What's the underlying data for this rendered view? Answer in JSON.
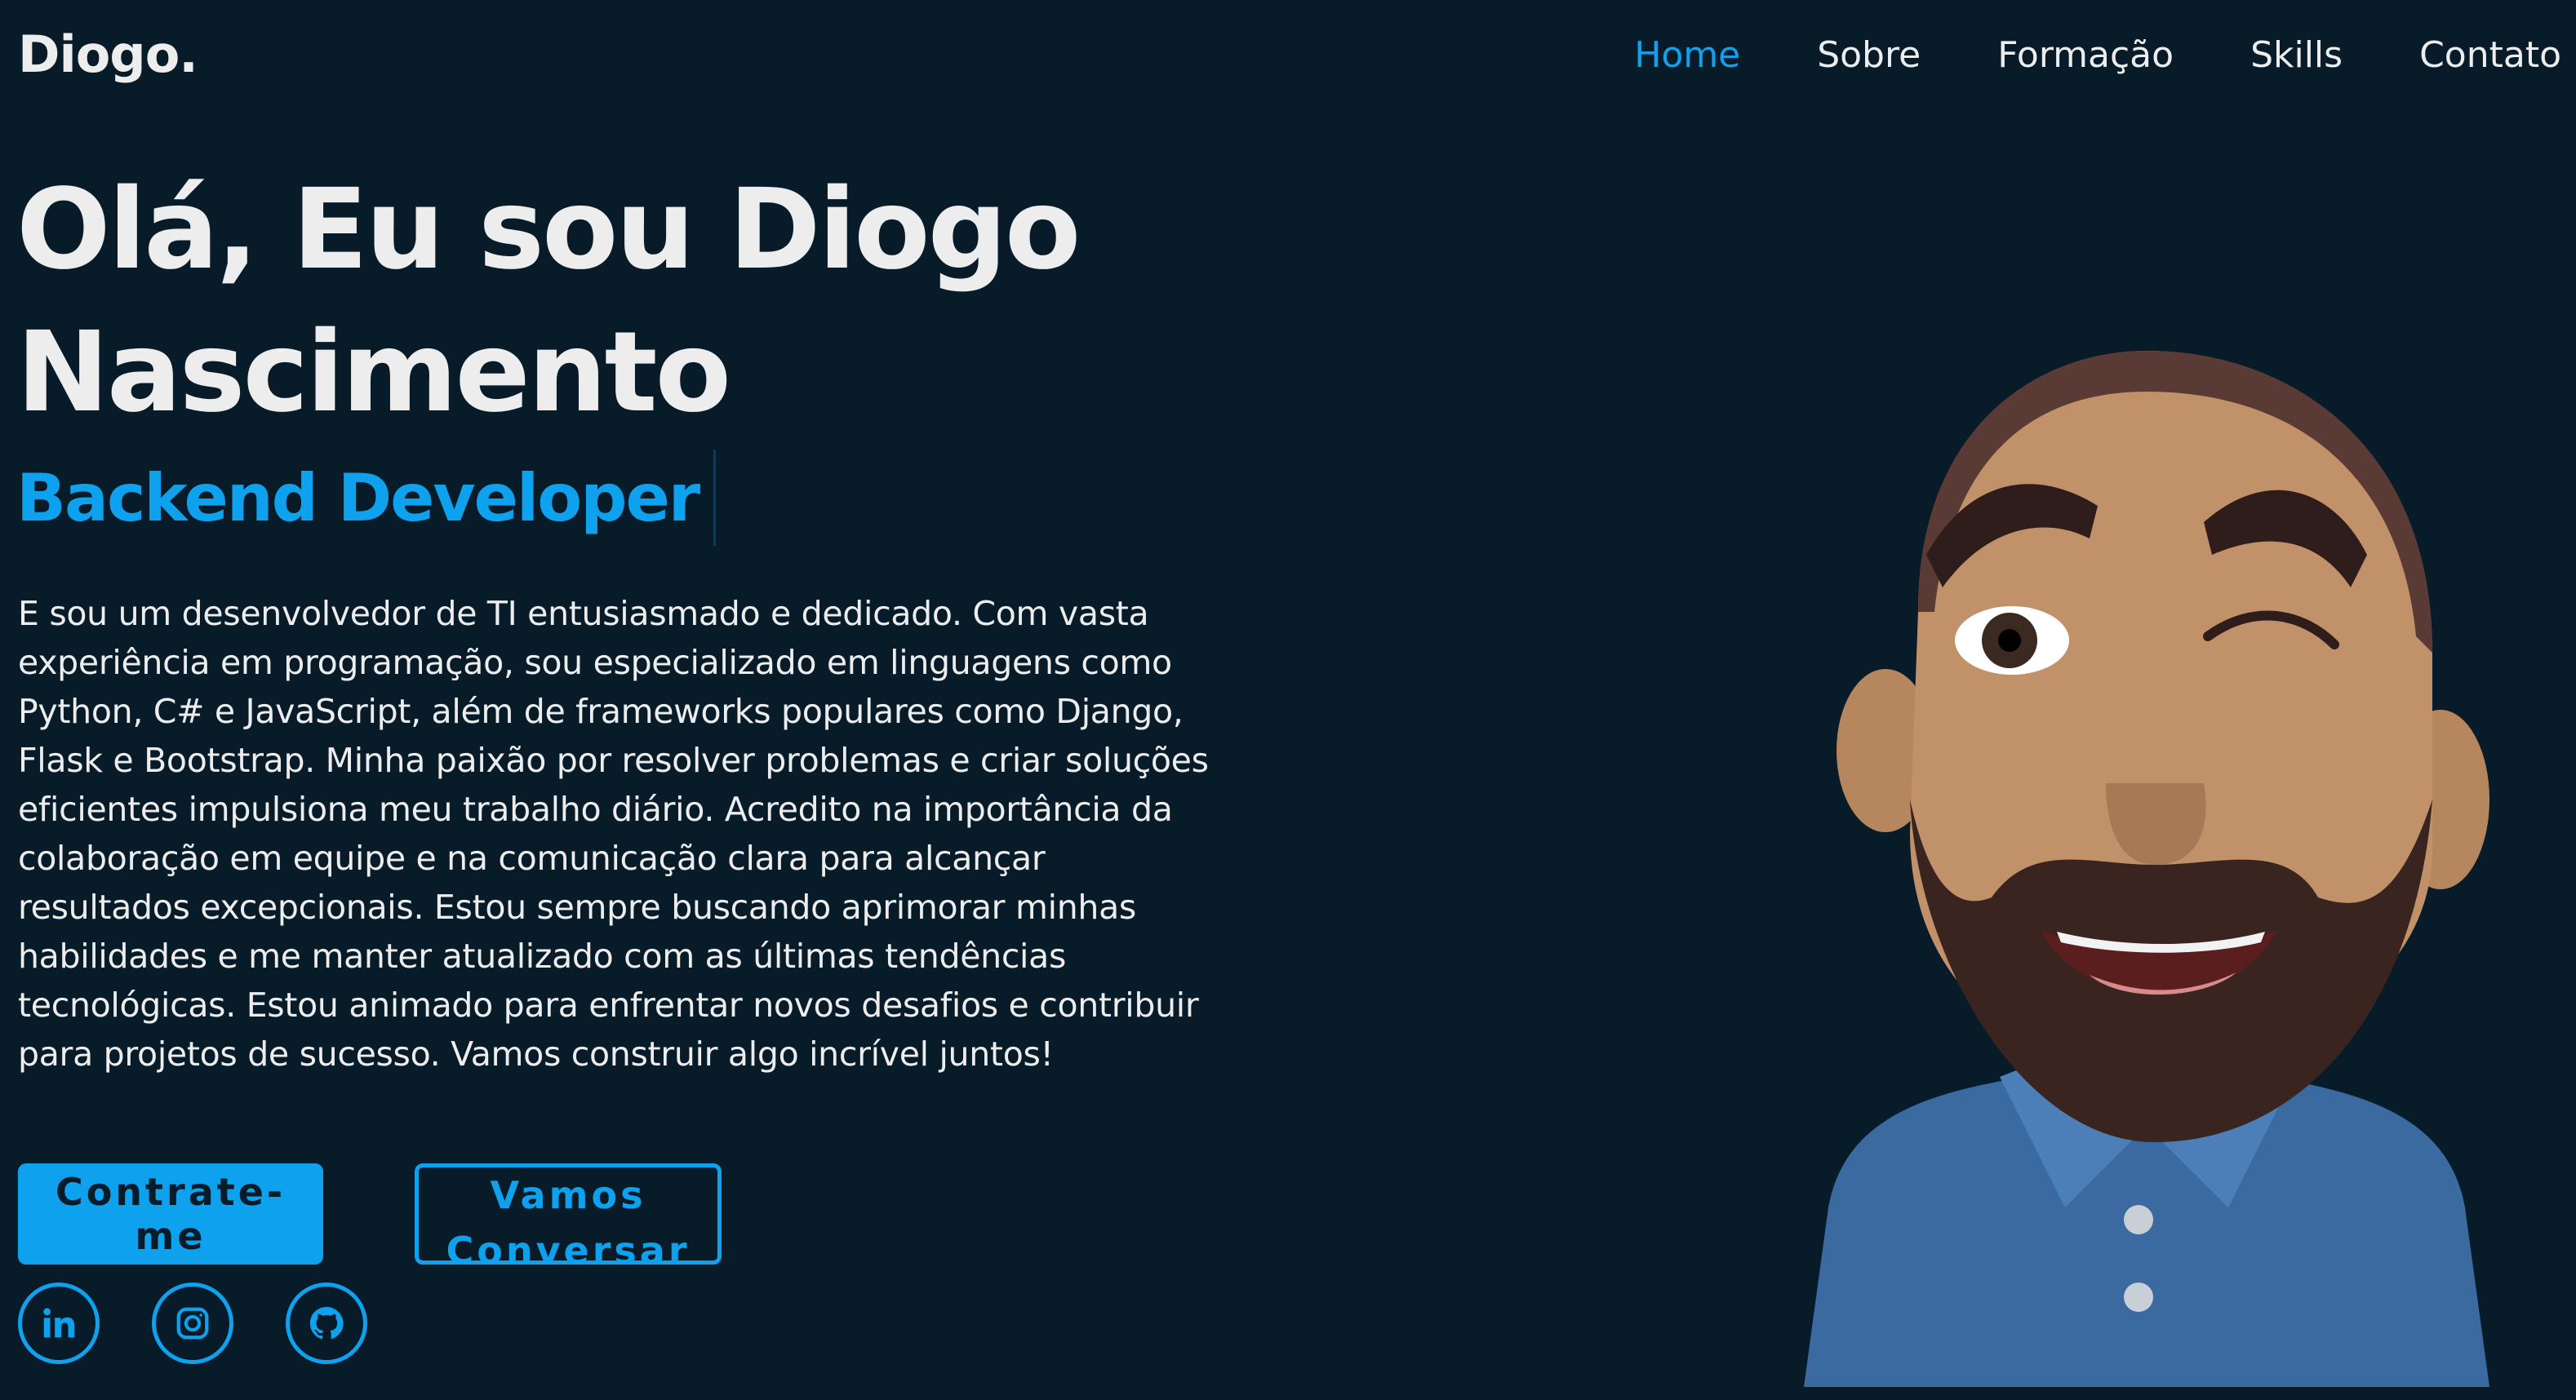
{
  "brand": {
    "logo": "Diogo."
  },
  "nav": {
    "items": [
      {
        "label": "Home",
        "active": true
      },
      {
        "label": "Sobre",
        "active": false
      },
      {
        "label": "Formação",
        "active": false
      },
      {
        "label": "Skills",
        "active": false
      },
      {
        "label": "Contato",
        "active": false
      }
    ]
  },
  "hero": {
    "title_line1": "Olá, Eu sou Diogo",
    "title_line2": "Nascimento",
    "role": "Backend Developer",
    "bio": "E sou um desenvolvedor de TI entusiasmado e dedicado. Com vasta experiência em programação, sou especializado em linguagens como Python, C# e JavaScript, além de frameworks populares como Django, Flask e Bootstrap. Minha paixão por resolver problemas e criar soluções eficientes impulsiona meu trabalho diário. Acredito na importância da colaboração em equipe e na comunicação clara para alcançar resultados excepcionais. Estou sempre buscando aprimorar minhas habilidades e me manter atualizado com as últimas tendências tecnológicas. Estou animado para enfrentar novos desafios e contribuir para projetos de sucesso. Vamos construir algo incrível juntos!",
    "primary_button": "Contrate-me",
    "secondary_button": "Vamos Conversar"
  },
  "socials": [
    {
      "icon": "linkedin-icon"
    },
    {
      "icon": "instagram-icon"
    },
    {
      "icon": "github-icon"
    }
  ],
  "avatar": {
    "icon": "avatar-illustration"
  },
  "colors": {
    "background": "#081b29",
    "accent": "#0ea1ed",
    "text": "#ededed"
  }
}
